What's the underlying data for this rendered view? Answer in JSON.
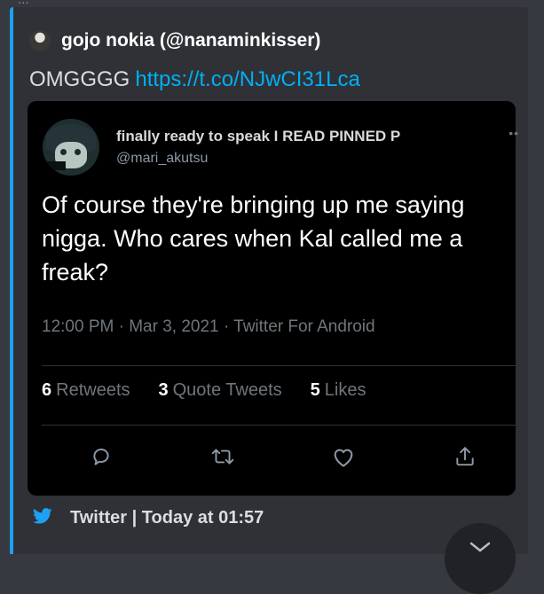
{
  "top_cutoff_text": "...",
  "embed": {
    "accent_color": "#1da1f2",
    "author": {
      "name": "gojo nokia (@nanaminkisser)"
    },
    "description": {
      "text": "OMGGGG",
      "link": "https://t.co/NJwCI31Lca"
    },
    "tweet": {
      "display_name": "finally ready to speak I READ PINNED P",
      "handle": "@mari_akutsu",
      "more_icon": "more-dots-icon",
      "text": "Of course they're bringing up me saying nigga. Who cares when Kal called me a freak?",
      "meta": "12:00 PM · Mar 3, 2021 · Twitter For Android",
      "stats": [
        {
          "count": "6",
          "label": "Retweets"
        },
        {
          "count": "3",
          "label": "Quote Tweets"
        },
        {
          "count": "5",
          "label": "Likes"
        }
      ],
      "actions": [
        "reply-icon",
        "retweet-icon",
        "like-icon",
        "share-icon"
      ]
    },
    "footer": {
      "icon": "twitter-bird-icon",
      "text": "Twitter | Today at 01:57"
    }
  },
  "scroll_button_icon": "chevron-down-icon"
}
